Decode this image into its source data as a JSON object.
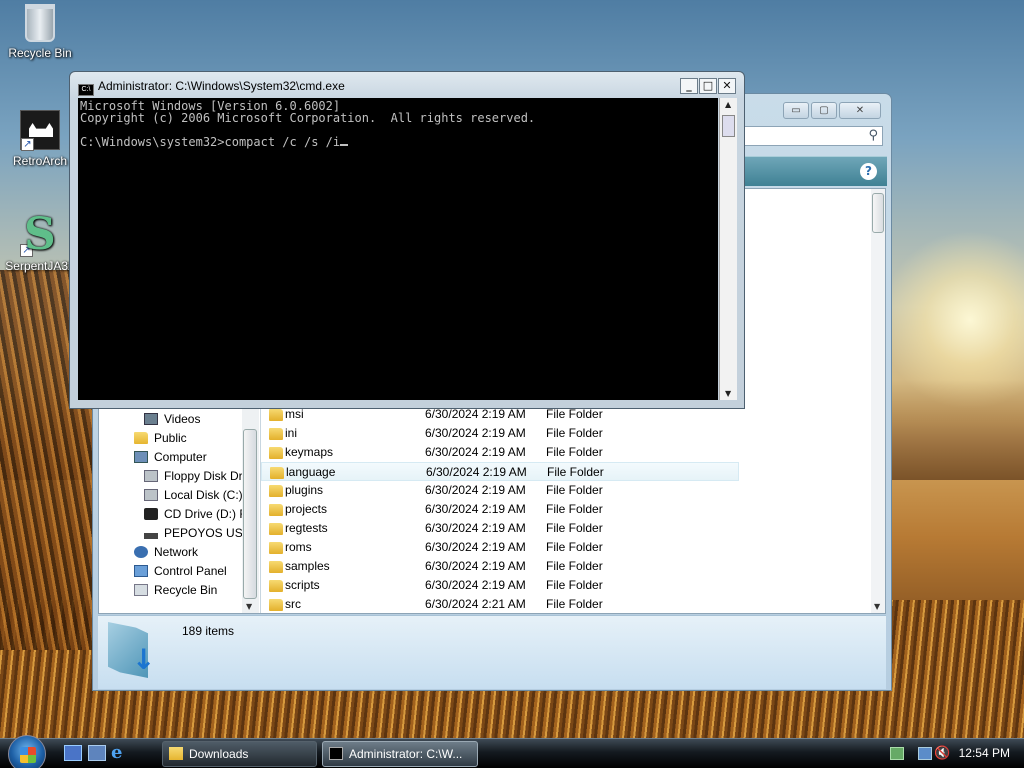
{
  "desktop": {
    "icons": [
      {
        "label": "Recycle Bin"
      },
      {
        "label": "RetroArch"
      },
      {
        "label": "SerpentJA32"
      }
    ]
  },
  "cmd_window": {
    "title": "Administrator: C:\\Windows\\System32\\cmd.exe",
    "icon_text": "C:\\",
    "lines": [
      "Microsoft Windows [Version 6.0.6002]",
      "Copyright (c) 2006 Microsoft Corporation.  All rights reserved.",
      "",
      "C:\\Windows\\system32>compact /c /s /i"
    ]
  },
  "explorer": {
    "nav_items": [
      {
        "label": "Videos",
        "icon": "video-folder-icon"
      },
      {
        "label": "Public",
        "icon": "folder-icon"
      },
      {
        "label": "Computer",
        "icon": "computer-icon"
      },
      {
        "label": "Floppy Disk Dr",
        "icon": "floppy-icon"
      },
      {
        "label": "Local Disk (C:)",
        "icon": "hard-disk-icon"
      },
      {
        "label": "CD Drive (D:) R",
        "icon": "cd-drive-icon"
      },
      {
        "label": "PEPOYOS USB",
        "icon": "usb-drive-icon"
      },
      {
        "label": "Network",
        "icon": "network-icon"
      },
      {
        "label": "Control Panel",
        "icon": "control-panel-icon"
      },
      {
        "label": "Recycle Bin",
        "icon": "recycle-bin-icon"
      }
    ],
    "files": [
      {
        "name": "msi",
        "date": "6/30/2024 2:19 AM",
        "type": "File Folder"
      },
      {
        "name": "ini",
        "date": "6/30/2024 2:19 AM",
        "type": "File Folder"
      },
      {
        "name": "keymaps",
        "date": "6/30/2024 2:19 AM",
        "type": "File Folder"
      },
      {
        "name": "language",
        "date": "6/30/2024 2:19 AM",
        "type": "File Folder"
      },
      {
        "name": "plugins",
        "date": "6/30/2024 2:19 AM",
        "type": "File Folder"
      },
      {
        "name": "projects",
        "date": "6/30/2024 2:19 AM",
        "type": "File Folder"
      },
      {
        "name": "regtests",
        "date": "6/30/2024 2:19 AM",
        "type": "File Folder"
      },
      {
        "name": "roms",
        "date": "6/30/2024 2:19 AM",
        "type": "File Folder"
      },
      {
        "name": "samples",
        "date": "6/30/2024 2:19 AM",
        "type": "File Folder"
      },
      {
        "name": "scripts",
        "date": "6/30/2024 2:19 AM",
        "type": "File Folder"
      },
      {
        "name": "src",
        "date": "6/30/2024 2:21 AM",
        "type": "File Folder"
      }
    ],
    "item_count": "189 items"
  },
  "taskbar": {
    "buttons": [
      {
        "label": "Downloads"
      },
      {
        "label": "Administrator: C:\\W..."
      }
    ],
    "clock": "12:54 PM"
  }
}
